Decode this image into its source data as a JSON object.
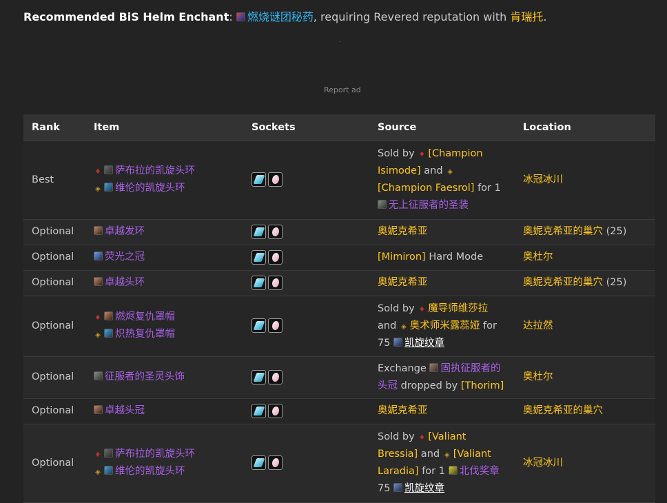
{
  "enchant": {
    "label": "Recommended BiS Helm Enchant",
    "colon": ":",
    "name": "燃烧谜团秘药",
    "text_mid": ", requiring Revered reputation with ",
    "faction": "肯瑞托",
    "text_end": "."
  },
  "ad": {
    "label": "Report ad"
  },
  "table": {
    "headers": [
      "Rank",
      "Item",
      "Sockets",
      "Source",
      "Location"
    ],
    "rows": [
      {
        "rank": "Best",
        "items": [
          {
            "faction": "horde",
            "icon": "helm-icon",
            "name": "萨布拉的凯旋头环"
          },
          {
            "faction": "alliance",
            "icon": "helm-icon",
            "name": "维伦的凯旋头环"
          }
        ],
        "source": {
          "t1": "Sold by ",
          "n1": "[Champion Isimode]",
          "t2": " and ",
          "n2": "[Champion Faesrol]",
          "t3": " for 1 ",
          "n3": "无上征服者的圣装"
        },
        "location": "冰冠冰川"
      },
      {
        "rank": "Optional",
        "items": [
          {
            "faction": "",
            "icon": "helm-icon",
            "name": "卓越发环"
          }
        ],
        "source": {
          "n1": "奥妮克希亚"
        },
        "location": "奥妮克希亚的巢穴",
        "location_suffix": " (25)"
      },
      {
        "rank": "Optional",
        "items": [
          {
            "faction": "",
            "icon": "helm-icon",
            "name": "荧光之冠"
          }
        ],
        "source": {
          "n1": "[Mimiron]",
          "t1": " Hard Mode"
        },
        "location": "奥杜尔"
      },
      {
        "rank": "Optional",
        "items": [
          {
            "faction": "",
            "icon": "helm-icon",
            "name": "卓越头环"
          }
        ],
        "source": {
          "n1": "奥妮克希亚"
        },
        "location": "奥妮克希亚的巢穴",
        "location_suffix": " (25)"
      },
      {
        "rank": "Optional",
        "items": [
          {
            "faction": "horde",
            "icon": "helm-icon",
            "name": "燃烬复仇罩帽"
          },
          {
            "faction": "alliance",
            "icon": "helm-icon",
            "name": "炽热复仇罩帽"
          }
        ],
        "source": {
          "t1": "Sold by ",
          "n1": "魔导师维莎拉",
          "t2": " and ",
          "n2": "奥术师米露蕊娅",
          "t3": " for 75 ",
          "n3": "凯旋纹章"
        },
        "location": "达拉然"
      },
      {
        "rank": "Optional",
        "items": [
          {
            "faction": "",
            "icon": "helm-icon",
            "name": "征服者的圣灵头饰"
          }
        ],
        "source": {
          "t1": "Exchange ",
          "n1": "固执征服者的头冠",
          "t2": " dropped by ",
          "n2": "[Thorim]"
        },
        "location": "奥杜尔"
      },
      {
        "rank": "Optional",
        "items": [
          {
            "faction": "",
            "icon": "helm-icon",
            "name": "卓越头冠"
          }
        ],
        "source": {
          "n1": "奥妮克希亚"
        },
        "location": "奥妮克希亚的巢穴"
      },
      {
        "rank": "Optional",
        "items": [
          {
            "faction": "horde",
            "icon": "helm-icon",
            "name": "萨布拉的凯旋头环"
          },
          {
            "faction": "alliance",
            "icon": "helm-icon",
            "name": "维伦的凯旋头环"
          }
        ],
        "source": {
          "t1": "Sold by ",
          "n1": "[Valiant Bressia]",
          "t2": " and ",
          "n2": "[Valiant Laradia]",
          "t3": " for 1 ",
          "n3": "北伐奖章",
          "t4": " 75 ",
          "n4": "凯旋纹章"
        },
        "location": "冰冠冰川"
      }
    ]
  }
}
